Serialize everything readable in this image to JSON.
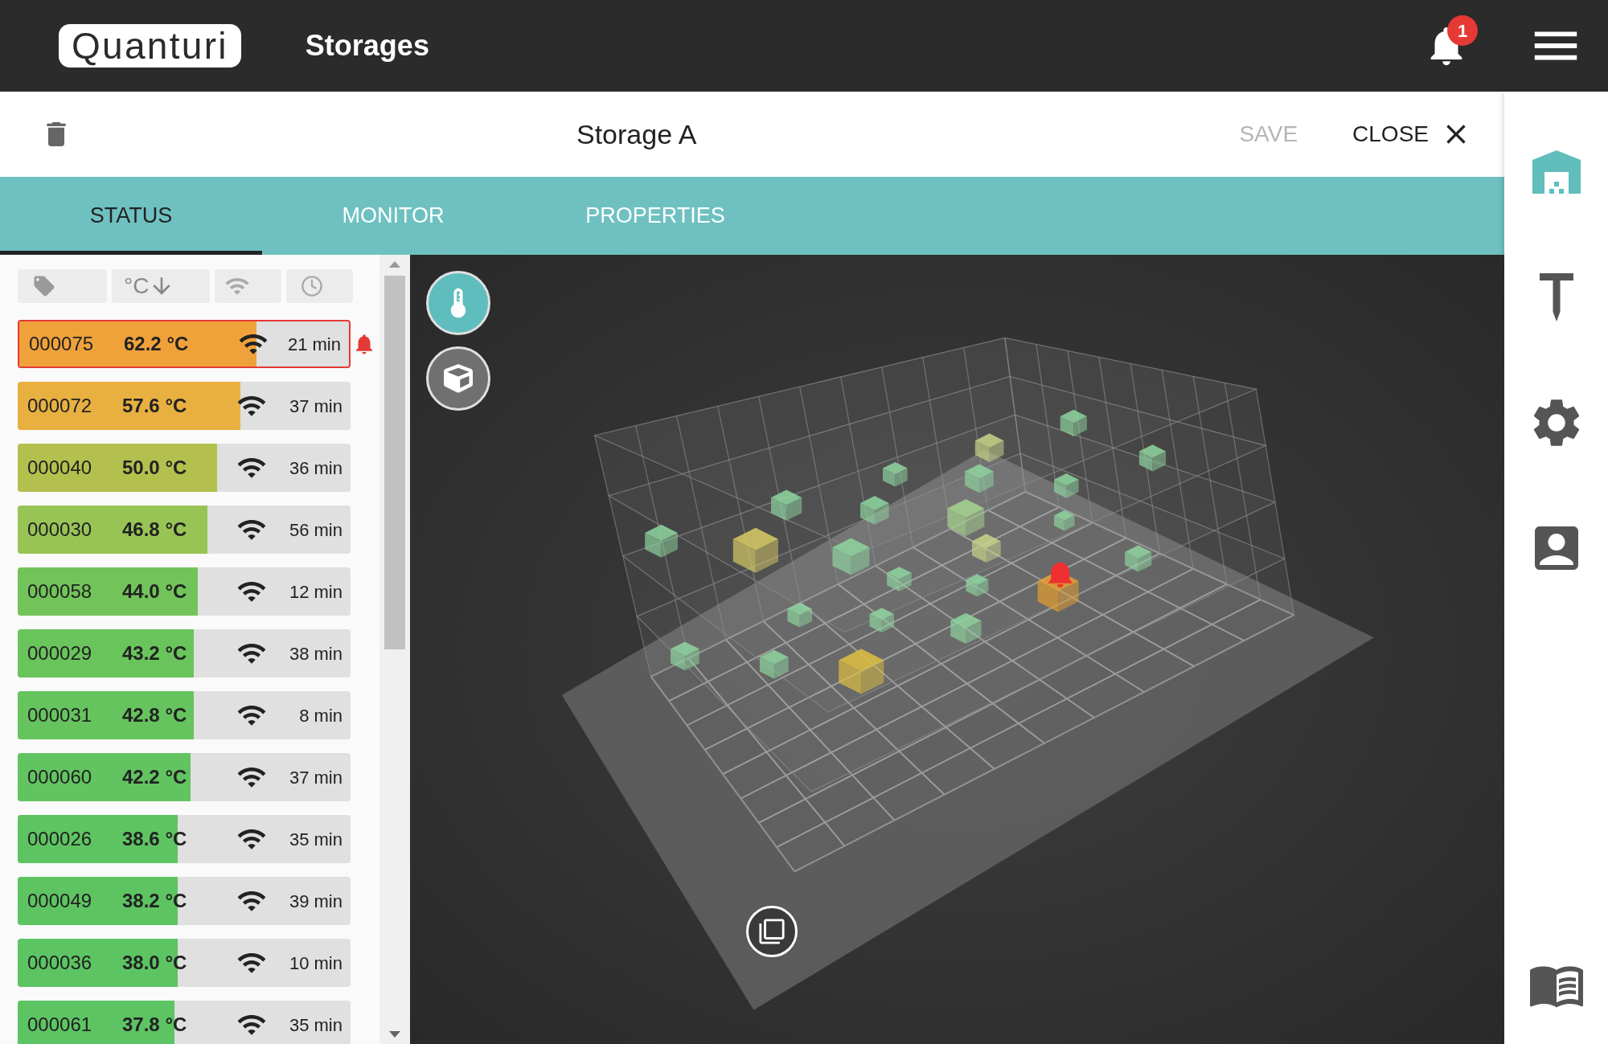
{
  "app": {
    "logo": "Quanturi",
    "section": "Storages",
    "notification_count": "1"
  },
  "storage": {
    "title": "Storage A",
    "save_label": "SAVE",
    "save_disabled": true,
    "close_label": "CLOSE"
  },
  "tabs": [
    {
      "label": "STATUS",
      "selected": true
    },
    {
      "label": "MONITOR",
      "selected": false
    },
    {
      "label": "PROPERTIES",
      "selected": false
    }
  ],
  "list_header": {
    "temperature_unit": "°C"
  },
  "sensors": [
    {
      "id": "000075",
      "temperature": "62.2 °C",
      "age": "21 min",
      "level": 0.72,
      "color": "#f0a23a",
      "alert": true
    },
    {
      "id": "000072",
      "temperature": "57.6 °C",
      "age": "37 min",
      "level": 0.67,
      "color": "#e8b040",
      "alert": false
    },
    {
      "id": "000040",
      "temperature": "50.0 °C",
      "age": "36 min",
      "level": 0.6,
      "color": "#b3c04e",
      "alert": false
    },
    {
      "id": "000030",
      "temperature": "46.8 °C",
      "age": "56 min",
      "level": 0.57,
      "color": "#98c455",
      "alert": false
    },
    {
      "id": "000058",
      "temperature": "44.0 °C",
      "age": "12 min",
      "level": 0.54,
      "color": "#72c45a",
      "alert": false
    },
    {
      "id": "000029",
      "temperature": "43.2 °C",
      "age": "38 min",
      "level": 0.53,
      "color": "#6ac45c",
      "alert": false
    },
    {
      "id": "000031",
      "temperature": "42.8 °C",
      "age": "8 min",
      "level": 0.53,
      "color": "#66c45e",
      "alert": false
    },
    {
      "id": "000060",
      "temperature": "42.2 °C",
      "age": "37 min",
      "level": 0.52,
      "color": "#62c460",
      "alert": false
    },
    {
      "id": "000026",
      "temperature": "38.6 °C",
      "age": "35 min",
      "level": 0.48,
      "color": "#5ec462",
      "alert": false
    },
    {
      "id": "000049",
      "temperature": "38.2 °C",
      "age": "39 min",
      "level": 0.48,
      "color": "#5ec462",
      "alert": false
    },
    {
      "id": "000036",
      "temperature": "38.0 °C",
      "age": "10 min",
      "level": 0.48,
      "color": "#5dc463",
      "alert": false
    },
    {
      "id": "000061",
      "temperature": "37.8 °C",
      "age": "35 min",
      "level": 0.47,
      "color": "#5dc463",
      "alert": false
    }
  ],
  "view_modes": [
    {
      "kind": "temperature",
      "selected": true
    },
    {
      "kind": "cube",
      "selected": false
    }
  ],
  "sidebar": [
    {
      "kind": "warehouse",
      "selected": true
    },
    {
      "kind": "probe",
      "selected": false
    },
    {
      "kind": "settings",
      "selected": false
    },
    {
      "kind": "contact",
      "selected": false
    },
    {
      "kind": "manual",
      "selected": false
    }
  ]
}
